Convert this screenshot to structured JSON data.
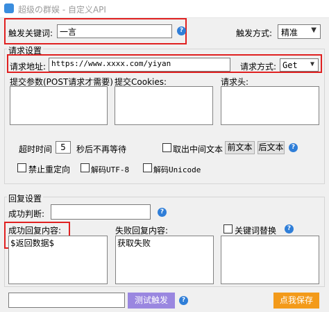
{
  "window": {
    "title": "超级の群娱 - 自定义API"
  },
  "trigger": {
    "keyword_label": "触发关键词:",
    "keyword_value": "一言",
    "mode_label": "触发方式:",
    "mode_value": "精准"
  },
  "request": {
    "section_label": "请求设置",
    "url_label": "请求地址:",
    "url_value": "https://www.xxxx.com/yiyan",
    "method_label": "请求方式:",
    "method_value": "Get",
    "params_label": "提交参数(POST请求才需要)",
    "cookies_label": "提交Cookies:",
    "headers_label": "请求头:",
    "timeout_label": "超时时间",
    "timeout_value": "5",
    "timeout_suffix": "秒后不再等待",
    "take_middle_label": "取出中间文本",
    "before_text_button": "前文本",
    "after_text_button": "后文本",
    "no_redirect_label": "禁止重定向",
    "decode_utf8_label": "解码UTF-8",
    "decode_unicode_label": "解码Unicode"
  },
  "reply": {
    "section_label": "回复设置",
    "success_judge_label": "成功判断:",
    "success_judge_value": "",
    "success_content_label": "成功回复内容:",
    "success_content_value": "$返回数据$",
    "fail_content_label": "失败回复内容:",
    "fail_content_value": "获取失败",
    "keyword_replace_label": "关键词替换"
  },
  "footer": {
    "test_input_value": "",
    "test_button": "测试触发",
    "save_button": "点我保存"
  },
  "colors": {
    "highlight_red": "#e02020",
    "test_button": "#9a87e0",
    "save_button": "#f39a1a",
    "help_icon": "#2f7ed8"
  }
}
